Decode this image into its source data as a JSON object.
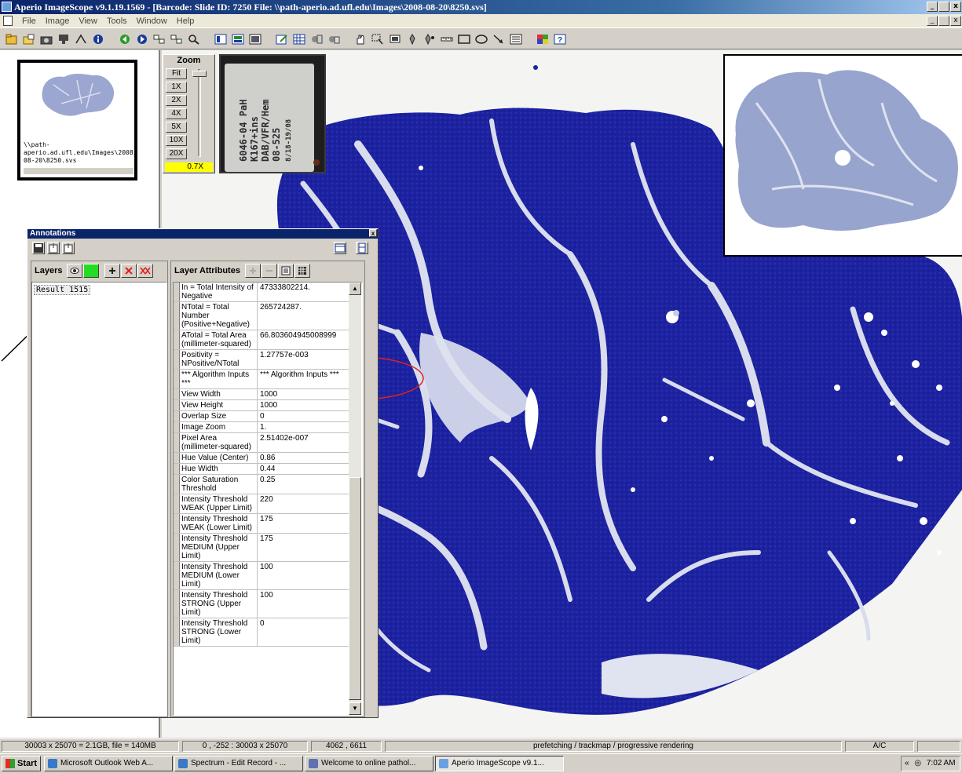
{
  "window": {
    "title": "Aperio ImageScope v9.1.19.1569  - [Barcode:  Slide ID: 7250  File: \\\\path-aperio.ad.ufl.edu\\Images\\2008-08-20\\8250.svs]",
    "min": "_",
    "max": " ",
    "close": "x"
  },
  "menu": {
    "items": [
      {
        "label": "File"
      },
      {
        "label": "Image"
      },
      {
        "label": "View"
      },
      {
        "label": "Tools"
      },
      {
        "label": "Window"
      },
      {
        "label": "Help"
      }
    ]
  },
  "toolbar": {
    "icons": [
      "open-icon",
      "folder-icon",
      "camera-icon",
      "network-icon",
      "fit-icon",
      "info-icon",
      "back-icon",
      "forward-icon",
      "link-icon",
      "link2-icon",
      "magnify-icon",
      "layout-icon",
      "layout2-icon",
      "layout3-icon",
      "edit-icon",
      "grid-icon",
      "extract-icon",
      "extract2-icon",
      "pan-icon",
      "region-icon",
      "stamp-icon",
      "pen-icon",
      "pen2-icon",
      "ruler-icon",
      "rectangle-icon",
      "ellipse-icon",
      "arrow-icon",
      "list-icon",
      "color-icon",
      "help-icon"
    ]
  },
  "thumbnail": {
    "path": "\\\\path-aperio.ad.ufl.edu\\Images\\2008-08-20\\8250.svs"
  },
  "zoom": {
    "title": "Zoom",
    "levels": [
      "Fit",
      "1X",
      "2X",
      "4X",
      "5X",
      "10X",
      "20X"
    ],
    "current": "0.7X"
  },
  "slide_label": {
    "lines": [
      "6046-04 PaH",
      "K167+ins",
      "DAB/VFR/Hem",
      "08-525",
      "8/18-19/08"
    ]
  },
  "annotations": {
    "title": "Annotations",
    "close": "x",
    "layers_label": "Layers",
    "layers": [
      {
        "name": "Result 1515"
      }
    ],
    "attributes_label": "Layer Attributes",
    "attributes": [
      {
        "name": "In = Total Intensity of Negative",
        "value": "47333802214."
      },
      {
        "name": "NTotal = Total Number (Positive+Negative)",
        "value": "265724287."
      },
      {
        "name": "ATotal = Total Area (millimeter-squared)",
        "value": "66.803604945008999"
      },
      {
        "name": "Positivity = NPositive/NTotal",
        "value": "1.27757e-003"
      },
      {
        "name": "*** Algorithm Inputs ***",
        "value": "*** Algorithm Inputs ***"
      },
      {
        "name": "View Width",
        "value": "1000"
      },
      {
        "name": "View Height",
        "value": "1000"
      },
      {
        "name": "Overlap Size",
        "value": "0"
      },
      {
        "name": "Image Zoom",
        "value": "1."
      },
      {
        "name": "Pixel Area (millimeter-squared)",
        "value": "2.51402e-007"
      },
      {
        "name": "Hue Value (Center)",
        "value": "0.86"
      },
      {
        "name": "Hue Width",
        "value": "0.44"
      },
      {
        "name": "Color Saturation Threshold",
        "value": "0.25"
      },
      {
        "name": "Intensity Threshold WEAK (Upper Limit)",
        "value": "220"
      },
      {
        "name": "Intensity Threshold WEAK (Lower Limit)",
        "value": "175"
      },
      {
        "name": "Intensity Threshold MEDIUM (Upper Limit)",
        "value": "175"
      },
      {
        "name": "Intensity Threshold MEDIUM (Lower Limit)",
        "value": "100"
      },
      {
        "name": "Intensity Threshold STRONG (Upper Limit)",
        "value": "100"
      },
      {
        "name": "Intensity Threshold STRONG (Lower Limit)",
        "value": "0"
      }
    ]
  },
  "status": {
    "size": "30003 x 25070 = 2.1GB, file = 140MB",
    "region": "0 , -252 : 30003 x 25070",
    "cursor": "4062 , 6611",
    "message": "prefetching / trackmap / progressive rendering",
    "mode": "A/C"
  },
  "taskbar": {
    "start": "Start",
    "tasks": [
      {
        "label": "Microsoft Outlook Web A..."
      },
      {
        "label": "Spectrum - Edit Record - ..."
      },
      {
        "label": "Welcome to online pathol..."
      },
      {
        "label": "Aperio ImageScope v9.1..."
      }
    ],
    "time": "7:02 AM"
  },
  "colors": {
    "stain": "#1a1f9a",
    "highlight": "#e02020",
    "zoom_badge": "#ffff00"
  }
}
